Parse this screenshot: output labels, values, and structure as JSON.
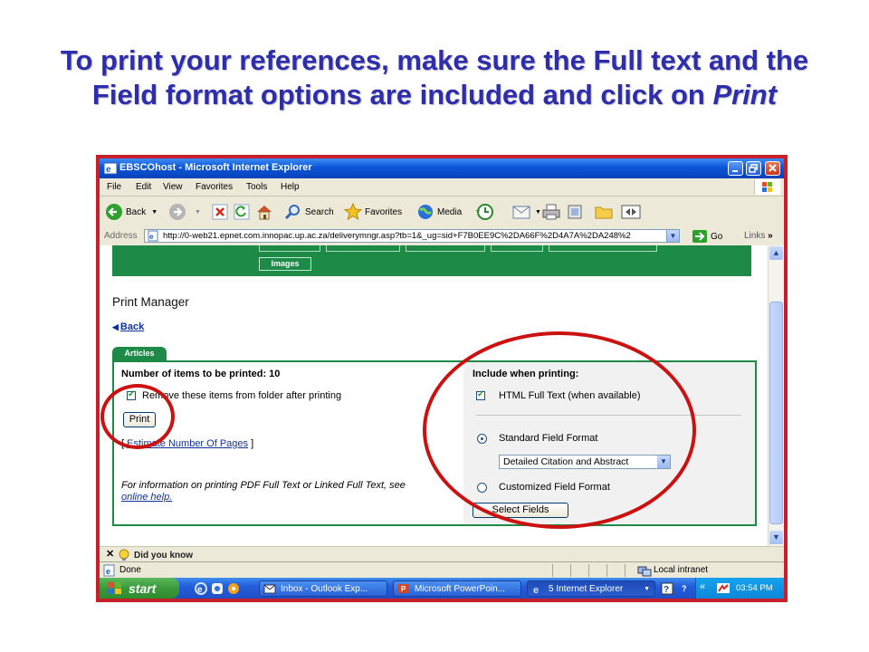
{
  "slide": {
    "title_line1": "To print your references, make sure the Full text and the",
    "title_line2_prefix": "Field format options are included and click on ",
    "title_line2_emphasis": "Print"
  },
  "window": {
    "title": "EBSCOhost - Microsoft Internet Explorer",
    "menu": [
      "File",
      "Edit",
      "View",
      "Favorites",
      "Tools",
      "Help"
    ],
    "toolbar": {
      "back": "Back",
      "search": "Search",
      "favorites": "Favorites",
      "media": "Media"
    },
    "address": {
      "label": "Address",
      "url": "http://0-web21.epnet.com.innopac.up.ac.za/deliverymngr.asp?tb=1&_ug=sid+F7B0EE9C%2DA66F%2D4A7A%2DA248%2",
      "go": "Go",
      "links": "Links"
    }
  },
  "page": {
    "images_tab": "Images",
    "heading": "Print Manager",
    "back_link": "Back",
    "articles_tab": "Articles",
    "items_count_label": "Number of items to be printed: 10",
    "remove_items_label": "Remove these items from folder after printing",
    "remove_items_checked": true,
    "print_button": "Print",
    "estimate_open": "[ ",
    "estimate_link": "Estimate Number Of Pages",
    "estimate_close": " ]",
    "pdf_info": "For information on printing PDF Full Text or Linked Full Text, see",
    "online_help": "online help.",
    "include_label": "Include when printing:",
    "html_full_text_label": "HTML Full Text (when available)",
    "html_full_text_checked": true,
    "standard_format_label": "Standard Field Format",
    "standard_format_selected": true,
    "format_select_value": "Detailed Citation and Abstract",
    "customized_format_label": "Customized Field Format",
    "select_fields_button": "Select Fields"
  },
  "bottom": {
    "did_you_know": "Did you know",
    "status_done": "Done",
    "status_zone": "Local intranet"
  },
  "taskbar": {
    "start": "start",
    "tasks": [
      "Inbox - Outlook Exp...",
      "Microsoft PowerPoin...",
      "5 Internet Explorer"
    ],
    "clock": "03:54 PM"
  },
  "colors": {
    "title_blue": "#2d2dad",
    "frame_red": "#c8202a",
    "ebsco_green": "#1e8a47",
    "annotation_red": "#cc1111",
    "xp_blue": "#0a55d8"
  }
}
